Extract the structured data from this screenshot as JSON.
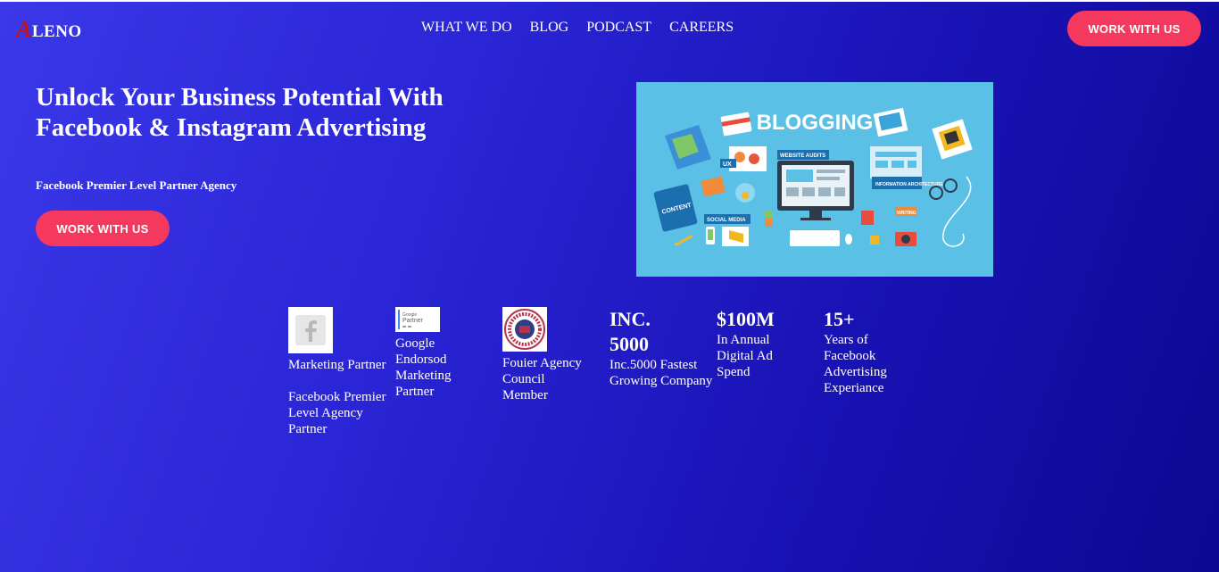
{
  "logo": {
    "first_letter": "A",
    "rest": "LENO"
  },
  "nav": [
    "WHAT WE DO",
    "BLOG",
    "PODCAST",
    "CAREERS"
  ],
  "header_cta": "WORK WITH US",
  "hero": {
    "title": "Unlock Your Business Potential With Facebook & Instagram Advertising",
    "subtitle": "Facebook Premier Level Partner Agency",
    "cta": "WORK WITH US"
  },
  "hero_image": {
    "heading": "BLOGGING",
    "labels": [
      "UX",
      "WEBSITE AUDITS",
      "INFORMATION ARCHITECTURE",
      "CONTENT",
      "SOCIAL MEDIA",
      "WRITING"
    ]
  },
  "stats": [
    {
      "badge": "facebook-icon",
      "line1": "Marketing Partner",
      "line2": "Facebook Premier Level Agency Partner"
    },
    {
      "badge": "google-partner-badge",
      "badge_text": "Google Partner",
      "line1": "Google Endorsod Marketing Partner"
    },
    {
      "badge": "agency-council-seal",
      "line1": "Fouier Agency Council Member"
    },
    {
      "big": "INC. 5000",
      "line1": "Inc.5000 Fastest Growing Company"
    },
    {
      "big": "$100M",
      "line1": "In Annual Digital Ad Spend"
    },
    {
      "big": "15+",
      "line1": "Years of Facebook Advertising Experiance"
    }
  ],
  "colors": {
    "accent": "#f5395e",
    "logo_letter": "#c1121f",
    "bg_start": "#3a38e8",
    "bg_end": "#0c0892",
    "image_bg": "#5bc0e6"
  }
}
